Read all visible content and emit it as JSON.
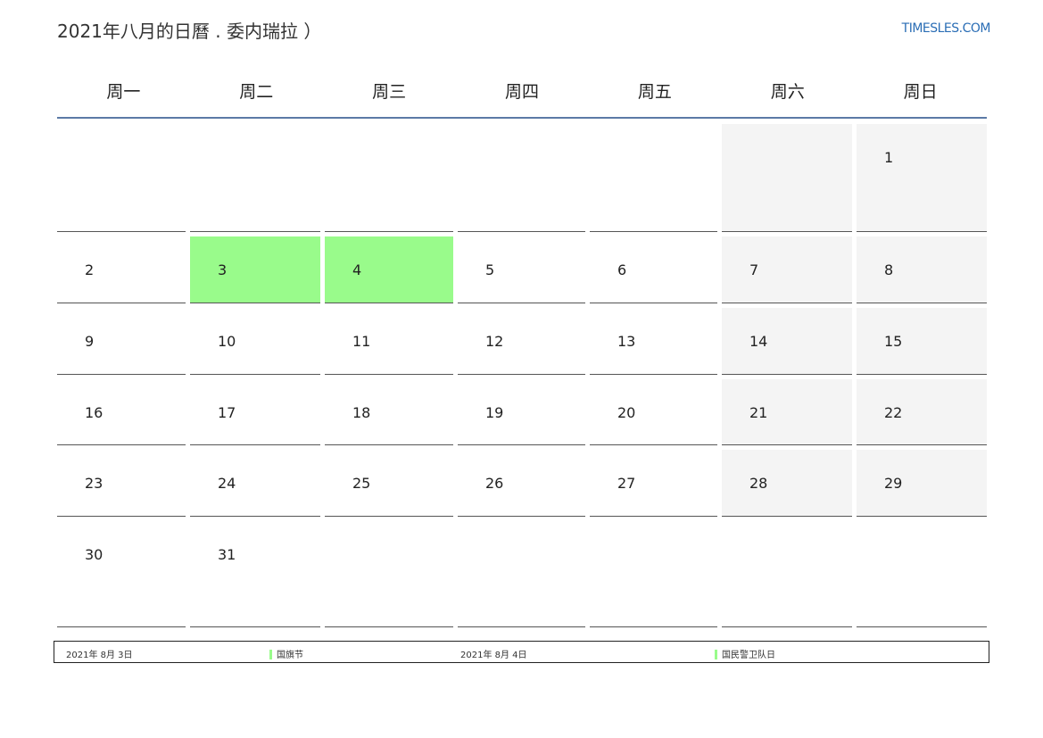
{
  "header": {
    "title": "2021年八月的日曆 . 委内瑞拉 ）",
    "site": "TIMESLES.COM"
  },
  "weekdays": [
    "周一",
    "周二",
    "周三",
    "周四",
    "周五",
    "周六",
    "周日"
  ],
  "weeks": [
    [
      "",
      "",
      "",
      "",
      "",
      "",
      "1"
    ],
    [
      "2",
      "3",
      "4",
      "5",
      "6",
      "7",
      "8"
    ],
    [
      "9",
      "10",
      "11",
      "12",
      "13",
      "14",
      "15"
    ],
    [
      "16",
      "17",
      "18",
      "19",
      "20",
      "21",
      "22"
    ],
    [
      "23",
      "24",
      "25",
      "26",
      "27",
      "28",
      "29"
    ],
    [
      "30",
      "31",
      "",
      "",
      "",
      "",
      ""
    ]
  ],
  "holiday_days": [
    "3",
    "4"
  ],
  "colors": {
    "holiday": "#99fb8b",
    "weekend": "#f4f4f4",
    "header_line": "#5b7aa6",
    "link": "#2a6db5"
  },
  "legend": [
    {
      "date": "2021年 8月 3日",
      "name": "国旗节"
    },
    {
      "date": "2021年 8月 4日",
      "name": "国民警卫队日"
    }
  ]
}
